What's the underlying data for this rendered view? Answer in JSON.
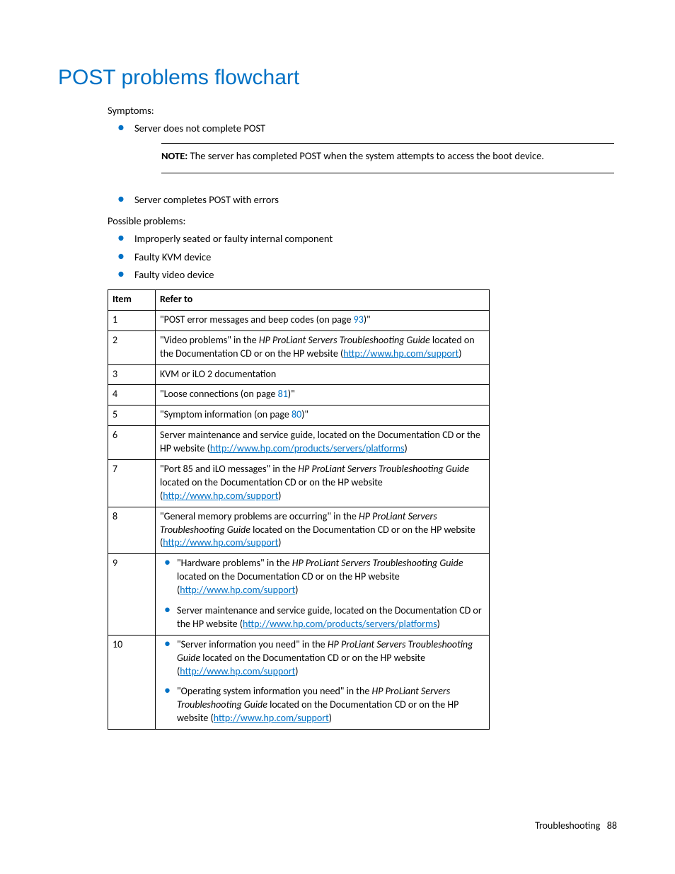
{
  "heading": "POST problems flowchart",
  "symptoms_label": "Symptoms:",
  "symptoms": [
    "Server does not complete POST",
    "Server completes POST with errors"
  ],
  "note": {
    "prefix": "NOTE:",
    "text": "  The server has completed POST when the system attempts to access the boot device."
  },
  "problems_label": "Possible problems:",
  "problems": [
    "Improperly seated or faulty internal component",
    "Faulty KVM device",
    "Faulty video device"
  ],
  "table": {
    "headers": [
      "Item",
      "Refer to"
    ],
    "rows": {
      "r1": {
        "item": "1",
        "t1": "\"POST error messages and beep codes (on page ",
        "pref": "93",
        "t2": ")\""
      },
      "r2": {
        "item": "2",
        "t1": "\"Video problems\" in the ",
        "it": "HP ProLiant Servers Troubleshooting Guide",
        "t2": " located on the Documentation CD or on the HP website (",
        "link": "http://www.hp.com/support",
        "t3": ")"
      },
      "r3": {
        "item": "3",
        "t1": "KVM or iLO 2 documentation"
      },
      "r4": {
        "item": "4",
        "t1": "\"Loose connections (on page ",
        "pref": "81",
        "t2": ")\""
      },
      "r5": {
        "item": "5",
        "t1": "\"Symptom information (on page ",
        "pref": "80",
        "t2": ")\""
      },
      "r6": {
        "item": "6",
        "t1": "Server maintenance and service guide, located on the Documentation CD or the HP website (",
        "link": "http://www.hp.com/products/servers/platforms",
        "t2": ")"
      },
      "r7": {
        "item": "7",
        "t1": "\"Port 85 and iLO messages\" in the ",
        "it": "HP ProLiant Servers Troubleshooting Guide",
        "t2": " located on the Documentation CD or on the HP website (",
        "link": "http://www.hp.com/support",
        "t3": ")"
      },
      "r8": {
        "item": "8",
        "t1": "\"General memory problems are occurring\" in the ",
        "it": "HP ProLiant Servers Troubleshooting Guide",
        "t2": " located on the Documentation CD or on the HP website (",
        "link": "http://www.hp.com/support",
        "t3": ")"
      },
      "r9": {
        "item": "9",
        "b1": {
          "t1": "\"Hardware problems\" in the ",
          "it": "HP ProLiant Servers Troubleshooting Guide",
          "t2": " located on the Documentation CD or on the HP website (",
          "link": "http://www.hp.com/support",
          "t3": ")"
        },
        "b2": {
          "t1": "Server maintenance and service guide, located on the Documentation CD or the HP website (",
          "link": "http://www.hp.com/products/servers/platforms",
          "t2": ")"
        }
      },
      "r10": {
        "item": "10",
        "b1": {
          "t1": "\"Server information you need\" in the ",
          "it": "HP ProLiant Servers Troubleshooting Guide",
          "t2": " located on the Documentation CD or on the HP website (",
          "link": "http://www.hp.com/support",
          "t3": ")"
        },
        "b2": {
          "t1": "\"Operating system information you need\" in the ",
          "it": "HP ProLiant Servers Troubleshooting Guide",
          "t2": " located on the Documentation CD or on the HP website (",
          "link": "http://www.hp.com/support",
          "t3": ")"
        }
      }
    }
  },
  "footer": {
    "section": "Troubleshooting",
    "page": "88"
  }
}
